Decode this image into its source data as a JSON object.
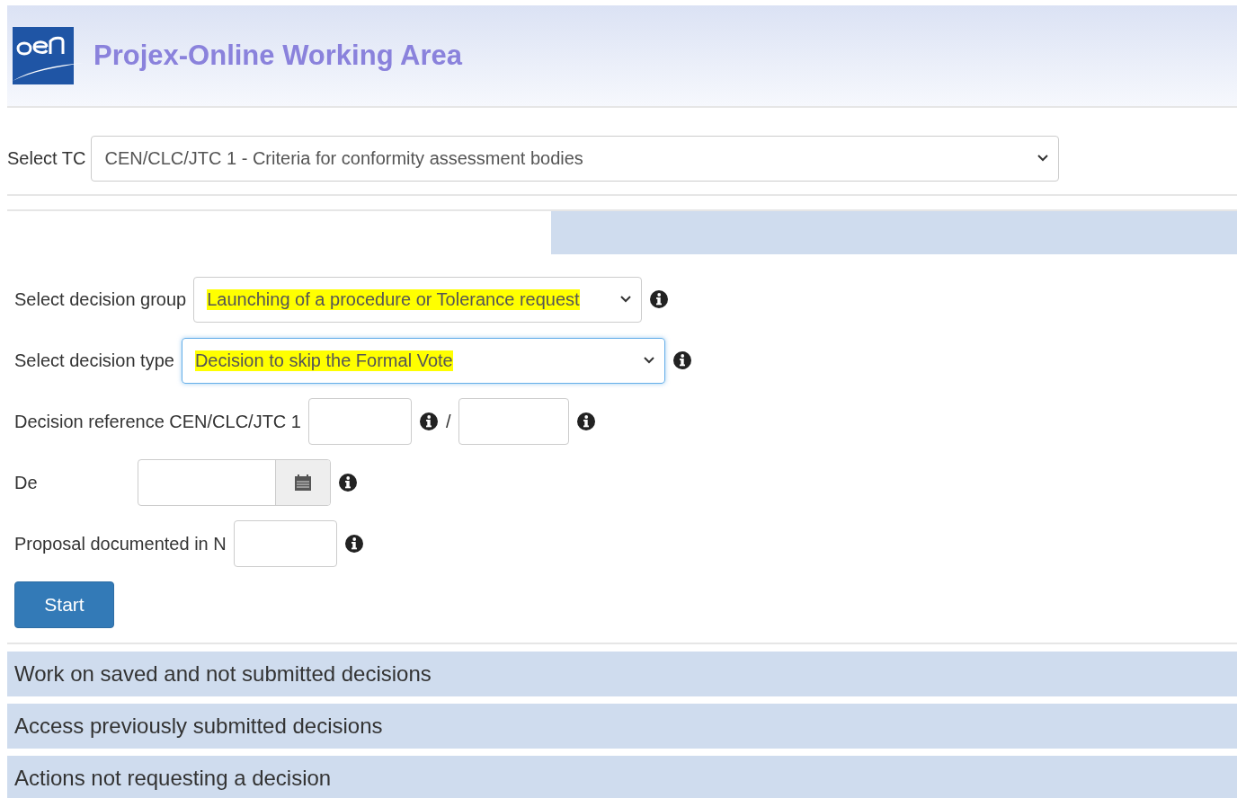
{
  "header": {
    "title": "Projex-Online Working Area"
  },
  "tc_select": {
    "label": "Select TC",
    "value": "CEN/CLC/JTC 1 - Criteria for conformity assessment bodies"
  },
  "form": [
    {
      "kind": "select",
      "label": "Select decision group",
      "value": "Launching of a procedure or Tolerance request",
      "highlighted": true,
      "focused": false
    },
    {
      "kind": "select",
      "label": "Select decision type",
      "value": "Decision to skip the Formal Vote",
      "highlighted": true,
      "focused": true
    },
    {
      "kind": "reference",
      "label": "Decision reference CEN/CLC/JTC 1",
      "separator": "/"
    },
    {
      "kind": "date",
      "label": "De"
    },
    {
      "kind": "input",
      "label": "Proposal documented in N"
    }
  ],
  "start_button": "Start",
  "sections": [
    "Work on saved and not submitted decisions",
    "Access previously submitted decisions",
    "Actions not requesting a decision"
  ]
}
